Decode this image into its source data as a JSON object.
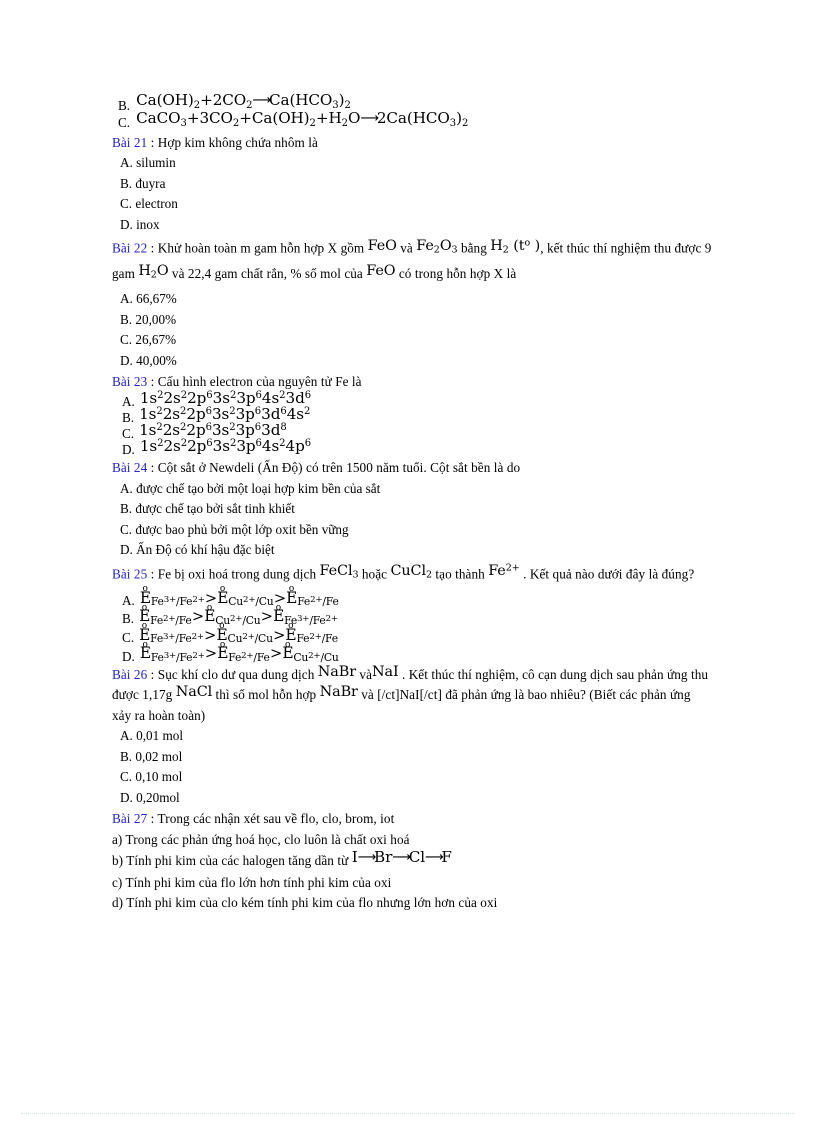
{
  "document": {
    "type": "chemistry-multiple-choice-worksheet",
    "language": "vi",
    "accent_color": "#2222cc",
    "text_color": "#000000",
    "background_color": "#ffffff"
  },
  "carryover_options": {
    "label_b": "B.",
    "label_c": "C.",
    "eq_b": {
      "lhs_1": "Ca(OH)",
      "lhs_1_sub": "2",
      "plus_1": "+2CO",
      "plus_1_sub": "2",
      "arrow": "⟶",
      "rhs": "Ca(HCO",
      "rhs_sub_1": "3",
      "rhs_close": ")",
      "rhs_sub_2": "2"
    },
    "eq_c": {
      "t1": "CaCO",
      "t1_sub": "3",
      "t2": "+3CO",
      "t2_sub": "2",
      "t3": "+Ca(OH)",
      "t3_sub": "2",
      "t4": "+H",
      "t4_sub": "2",
      "t5": "O",
      "arrow": "⟶",
      "t6": "2Ca(HCO",
      "t6_sub": "3",
      "t7": ")",
      "t7_sub": "2"
    }
  },
  "questions": [
    {
      "id": "bai-21",
      "tag": "Bài 21",
      "colon": " : ",
      "prompt": "Hợp kim  không  chứa nhôm  là",
      "options": [
        {
          "label": "A.",
          "text": "silumin"
        },
        {
          "label": "B.",
          "text": "đuyra"
        },
        {
          "label": "C.",
          "text": "electron"
        },
        {
          "label": "D.",
          "text": "inox"
        }
      ]
    },
    {
      "id": "bai-22",
      "tag": "Bài 22",
      "colon": " : ",
      "prompt_part_1": "Khử hoàn toàn m gam  hỗn hợp X gồm ",
      "f1": "FeO",
      "prompt_part_2": " và ",
      "f2_a": "Fe",
      "f2_sub_a": "2",
      "f2_b": "O",
      "f2_sub_b": "3",
      "prompt_part_3": " bằng ",
      "f3_a": "H",
      "f3_sub": "2",
      "f3_b": " (t",
      "f3_sup": "o",
      "f3_c": " )",
      "prompt_part_4": ", kết thúc thí nghiệm  thu được 9 gam ",
      "f4_a": "H",
      "f4_sub": "2",
      "f4_b": "O",
      "prompt_part_5": " và 22,4 gam  chất rắn, % số mol  của ",
      "f5": "FeO",
      "prompt_part_6": " có trong hỗn hợp X là",
      "options": [
        {
          "label": "A.",
          "text": "66,67%"
        },
        {
          "label": "B.",
          "text": "20,00%"
        },
        {
          "label": "C.",
          "text": "26,67%"
        },
        {
          "label": "D.",
          "text": "40,00%"
        }
      ]
    },
    {
      "id": "bai-23",
      "tag": "Bài 23",
      "colon": " : ",
      "prompt": "Cấu hình  electron  của nguyên  tử Fe là",
      "config_options": [
        {
          "label": "A.",
          "shells": [
            {
              "n": "1s",
              "e": "2"
            },
            {
              "n": "2s",
              "e": "2"
            },
            {
              "n": "2p",
              "e": "6"
            },
            {
              "n": "3s",
              "e": "2"
            },
            {
              "n": "3p",
              "e": "6"
            },
            {
              "n": "4s",
              "e": "2"
            },
            {
              "n": "3d",
              "e": "6"
            }
          ]
        },
        {
          "label": "B.",
          "shells": [
            {
              "n": "1s",
              "e": "2"
            },
            {
              "n": "2s",
              "e": "2"
            },
            {
              "n": "2p",
              "e": "6"
            },
            {
              "n": "3s",
              "e": "2"
            },
            {
              "n": "3p",
              "e": "6"
            },
            {
              "n": "3d",
              "e": "6"
            },
            {
              "n": "4s",
              "e": "2"
            }
          ]
        },
        {
          "label": "C.",
          "shells": [
            {
              "n": "1s",
              "e": "2"
            },
            {
              "n": "2s",
              "e": "2"
            },
            {
              "n": "2p",
              "e": "6"
            },
            {
              "n": "3s",
              "e": "2"
            },
            {
              "n": "3p",
              "e": "6"
            },
            {
              "n": "3d",
              "e": "8"
            }
          ]
        },
        {
          "label": "D.",
          "shells": [
            {
              "n": "1s",
              "e": "2"
            },
            {
              "n": "2s",
              "e": "2"
            },
            {
              "n": "2p",
              "e": "6"
            },
            {
              "n": "3s",
              "e": "2"
            },
            {
              "n": "3p",
              "e": "6"
            },
            {
              "n": "4s",
              "e": "2"
            },
            {
              "n": "4p",
              "e": "6"
            }
          ]
        }
      ]
    },
    {
      "id": "bai-24",
      "tag": "Bài 24",
      "colon": " : ",
      "prompt": "Cột sắt ở Newdeli  (Ấn Độ) có trên  1500 năm  tuổi.  Cột sắt bền là  do",
      "options": [
        {
          "label": "A.",
          "text": "được chế tạo bởi một loại  hợp  kim  bền của sắt"
        },
        {
          "label": "B.",
          "text": "được chế tạo bởi sắt tinh  khiết"
        },
        {
          "label": "C.",
          "text": "được bao phủ bởi một lớp  oxit  bền vững"
        },
        {
          "label": "D.",
          "text": "Ấn Độ có khí hậu đặc biệt"
        }
      ]
    },
    {
      "id": "bai-25",
      "tag": "Bài 25",
      "colon": " : ",
      "prompt_part_1": "Fe bị oxi hoá trong dung dịch ",
      "f1_a": "FeCl",
      "f1_sub": "3",
      "prompt_part_2": " hoặc ",
      "f2_a": "CuCl",
      "f2_sub": "2",
      "prompt_part_3": " tạo thành ",
      "f3_a": "Fe",
      "f3_sup": "2+",
      "prompt_part_4": " . Kết quả nào dưới đây là đúng?",
      "potential_options": [
        {
          "label": "A.",
          "terms": [
            {
              "base": "E",
              "deg": "o",
              "sub": "Fe",
              "sub_sup": "3+",
              "sub_tail": "/Fe",
              "sub_tail_sup": "2+"
            },
            {
              "base": "E",
              "deg": "o",
              "sub": "Cu",
              "sub_sup": "2+",
              "sub_tail": "/Cu",
              "sub_tail_sup": ""
            },
            {
              "base": "E",
              "deg": "o",
              "sub": "Fe",
              "sub_sup": "2+",
              "sub_tail": "/Fe",
              "sub_tail_sup": ""
            }
          ],
          "rel": ">"
        },
        {
          "label": "B.",
          "terms": [
            {
              "base": "E",
              "deg": "o",
              "sub": "Fe",
              "sub_sup": "2+",
              "sub_tail": "/Fe",
              "sub_tail_sup": ""
            },
            {
              "base": "E",
              "deg": "o",
              "sub": "Cu",
              "sub_sup": "2+",
              "sub_tail": "/Cu",
              "sub_tail_sup": ""
            },
            {
              "base": "E",
              "deg": "o",
              "sub": "Fe",
              "sub_sup": "3+",
              "sub_tail": "/Fe",
              "sub_tail_sup": "2+"
            }
          ],
          "rel": ">"
        },
        {
          "label": "C.",
          "terms": [
            {
              "base": "E",
              "deg": "o",
              "sub": "Fe",
              "sub_sup": "3+",
              "sub_tail": "/Fe",
              "sub_tail_sup": "2+"
            },
            {
              "base": "E",
              "deg": "o",
              "sub": "Cu",
              "sub_sup": "2+",
              "sub_tail": "/Cu",
              "sub_tail_sup": ""
            },
            {
              "base": "E",
              "deg": "o",
              "sub": "Fe",
              "sub_sup": "2+",
              "sub_tail": "/Fe",
              "sub_tail_sup": ""
            }
          ],
          "rel": ">"
        },
        {
          "label": "D.",
          "terms": [
            {
              "base": "E",
              "deg": "o",
              "sub": "Fe",
              "sub_sup": "3+",
              "sub_tail": "/Fe",
              "sub_tail_sup": "2+"
            },
            {
              "base": "E",
              "deg": "o",
              "sub": "Fe",
              "sub_sup": "2+",
              "sub_tail": "/Fe",
              "sub_tail_sup": ""
            },
            {
              "base": "E",
              "deg": "o",
              "sub": "Cu",
              "sub_sup": "2+",
              "sub_tail": "/Cu",
              "sub_tail_sup": ""
            }
          ],
          "rel": ">"
        }
      ]
    },
    {
      "id": "bai-26",
      "tag": "Bài 26",
      "colon": " : ",
      "prompt_part_1": "Sục khí clo dư qua dung dịch ",
      "f1_a": "NaBr",
      "prompt_part_2": " và",
      "f1_b": "NaI",
      "prompt_part_3": " . Kết thúc thí nghiệm,  cô cạn dung dịch sau phản ứng thu được 1,17g ",
      "f2": "NaCl",
      "prompt_part_4": " thì số mol hỗn hợp ",
      "f3": "NaBr",
      "prompt_part_5": " và [/ct]NaI[/ct] đã phản ứng là bao nhiêu?  (Biết các phản ứng xảy ra hoàn toàn)",
      "options": [
        {
          "label": "A.",
          "text": "0,01 mol"
        },
        {
          "label": "B.",
          "text": "0,02 mol"
        },
        {
          "label": "C.",
          "text": "0,10 mol"
        },
        {
          "label": "D.",
          "text": "0,20mol"
        }
      ]
    },
    {
      "id": "bai-27",
      "tag": "Bài 27",
      "colon": " : ",
      "prompt": "Trong các nhận  xét sau về flo,  clo,  brom,  iot",
      "statements": [
        {
          "label": "a)",
          "text": "Trong  các phản ứng hoá học, clo luôn  là chất oxi hoá",
          "has_chain": false
        },
        {
          "label": "b)",
          "text_prefix": "Tính  phi kim  của các halogen  tăng  dần từ ",
          "has_chain": true,
          "chain": [
            "I",
            "Br",
            "Cl",
            "F"
          ],
          "chain_arrow": "⟶"
        },
        {
          "label": "c)",
          "text": "Tính  phi kim  của flo lớn hơn tính  phi kim  của oxi",
          "has_chain": false
        },
        {
          "label": "d)",
          "text": "Tính  phi kim  của clo kém tính  phi kim  của flo nhưng  lớn hơn của oxi",
          "has_chain": false
        }
      ]
    }
  ]
}
